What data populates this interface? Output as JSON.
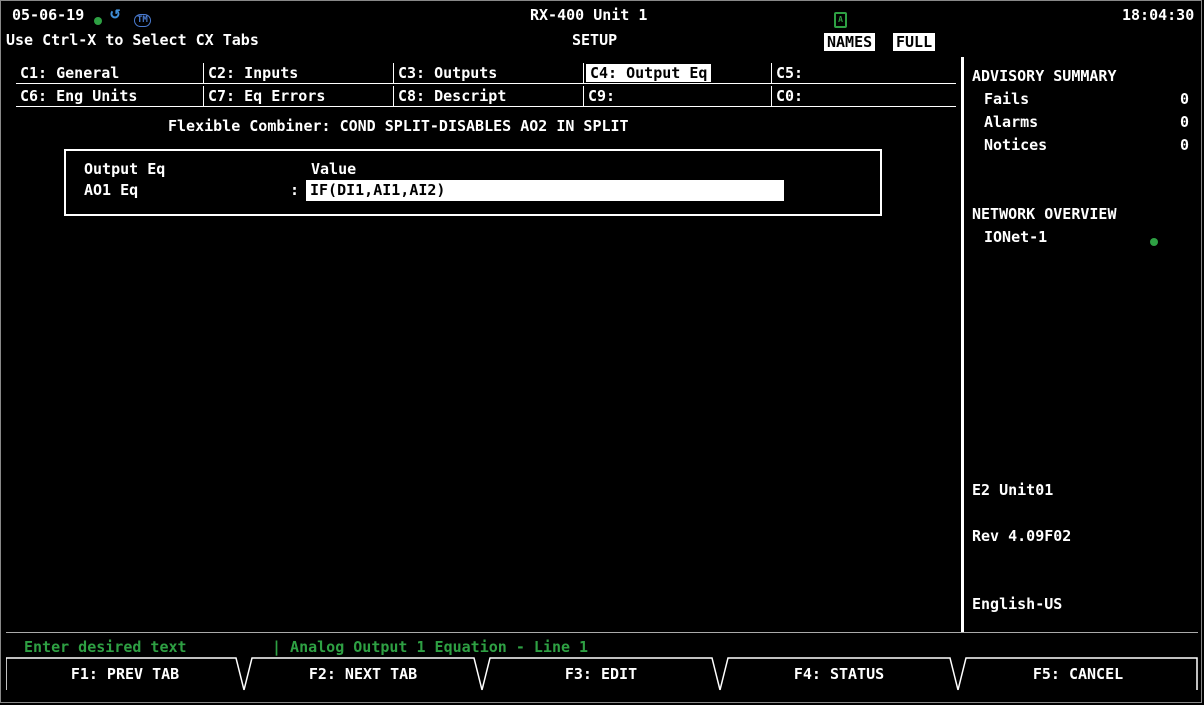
{
  "header": {
    "date": "05-06-19",
    "title": "RX-400 Unit 1",
    "time": "18:04:30",
    "hint": "Use Ctrl-X to Select CX Tabs",
    "mode": "SETUP",
    "tag_names": "NAMES",
    "tag_full": "FULL",
    "tm_label": "TM",
    "lock_label": "A"
  },
  "tabs": [
    {
      "label": "C1: General"
    },
    {
      "label": "C2: Inputs"
    },
    {
      "label": "C3: Outputs"
    },
    {
      "label": "C4: Output Eq",
      "selected": true
    },
    {
      "label": "C5:"
    },
    {
      "label": "C6: Eng Units"
    },
    {
      "label": "C7: Eq Errors"
    },
    {
      "label": "C8: Descript"
    },
    {
      "label": "C9:"
    },
    {
      "label": "C0:"
    }
  ],
  "content": {
    "heading": "Flexible Combiner: COND SPLIT-DISABLES AO2 IN SPLIT",
    "col_name": "Output Eq",
    "col_value": "Value",
    "row_label": "AO1 Eq",
    "row_sep": ":",
    "row_value": "IF(DI1,AI1,AI2)"
  },
  "advisory": {
    "title": "ADVISORY SUMMARY",
    "fails_label": "Fails",
    "fails": "0",
    "alarms_label": "Alarms",
    "alarms": "0",
    "notices_label": "Notices",
    "notices": "0"
  },
  "network": {
    "title": "NETWORK OVERVIEW",
    "item": "IONet-1"
  },
  "info": {
    "unit": "E2 Unit01",
    "rev": "Rev 4.09F02",
    "lang": "English-US"
  },
  "status": {
    "prompt": "Enter desired text",
    "detail": "| Analog Output 1 Equation - Line 1"
  },
  "fkeys": [
    "F1: PREV TAB",
    "F2: NEXT TAB",
    "F3: EDIT",
    "F4: STATUS",
    "F5: CANCEL"
  ],
  "colors": {
    "accent_green": "#2ea043",
    "icon_blue": "#3f8fd8",
    "bg": "#000000",
    "fg": "#ffffff"
  }
}
